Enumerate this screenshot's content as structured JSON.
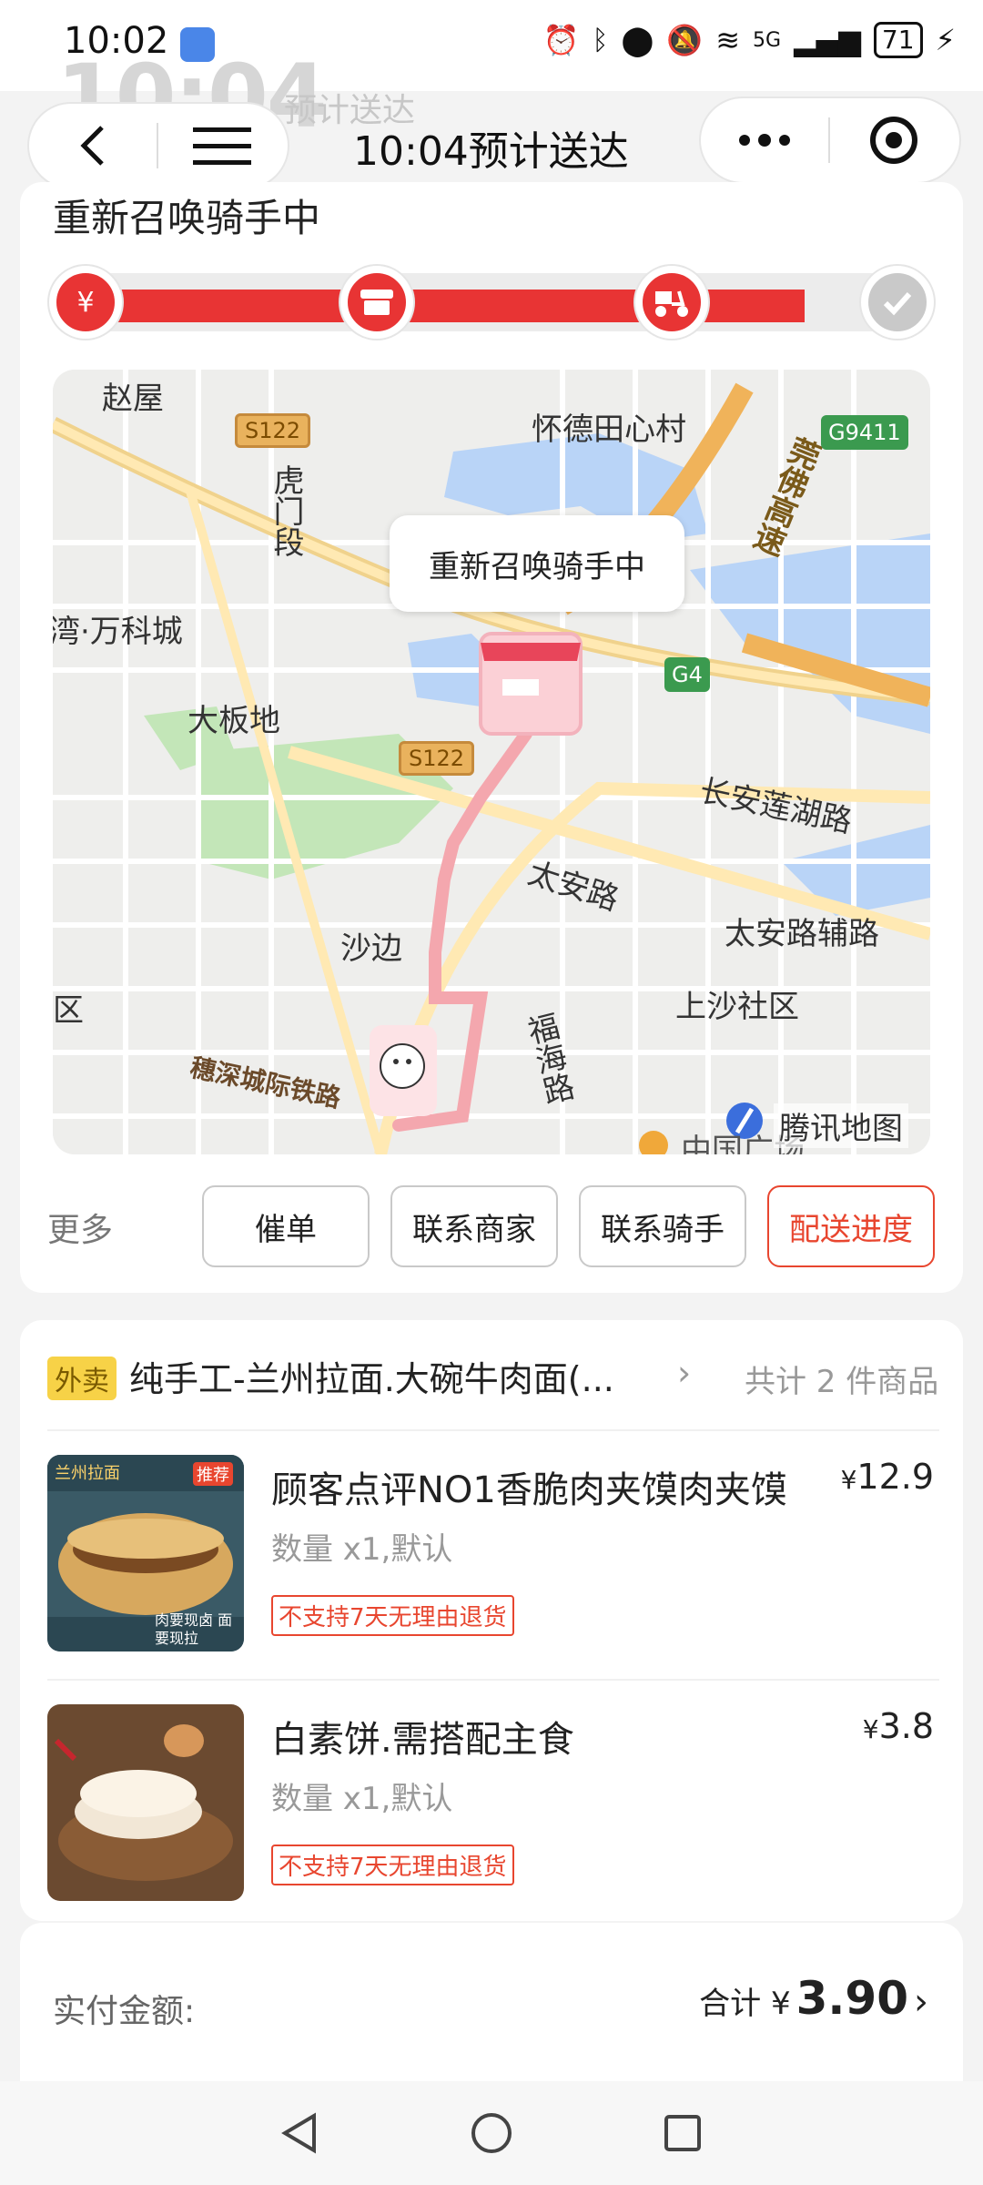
{
  "status_bar": {
    "time": "10:02",
    "network": "5G",
    "battery": "71"
  },
  "header": {
    "overlay_time": "10:04",
    "overlay_label": "预计送达",
    "title": "10:04预计送达"
  },
  "order_status": {
    "text": "重新召唤骑手中",
    "progress": 0.86,
    "step_icons": [
      "payment-icon",
      "store-icon",
      "scooter-icon",
      "check-icon"
    ]
  },
  "map": {
    "bubble": "重新召唤骑手中",
    "labels": {
      "zhaowu": "赵屋",
      "huaide": "怀德田心村",
      "humen": "虎门段",
      "vanke": "湾·万科城",
      "dabandi": "大板地",
      "changan": "长安莲湖路",
      "taian": "太安路",
      "taian_fu": "太安路辅路",
      "shabian": "沙边",
      "shangsha": "上沙社区",
      "fuhai": "福海路",
      "suishen": "穗深城际铁路",
      "guanfo": "莞佛高速",
      "qu": "区",
      "bottom_partial": "中国广场"
    },
    "shields": {
      "s122a": "S122",
      "s122b": "S122",
      "g4": "G4",
      "g9411": "G9411"
    },
    "watermark": "腾讯地图"
  },
  "actions": {
    "more": "更多",
    "urge": "催单",
    "contact_merchant": "联系商家",
    "contact_rider": "联系骑手",
    "delivery_progress": "配送进度"
  },
  "shop": {
    "tag": "外卖",
    "name": "纯手工-兰州拉面.大碗牛肉面(...",
    "item_count": "共计 2 件商品"
  },
  "items": [
    {
      "name": "顾客点评NO1香脆肉夹馍肉夹馍",
      "qty": "数量 x1,默认",
      "badge": "不支持7天无理由退货",
      "currency": "¥",
      "price": "12.9",
      "thumb_tag": "推荐",
      "thumb_title": "兰州拉面",
      "thumb_caption": "肉要现卤 面要现拉"
    },
    {
      "name": "白素饼.需搭配主食",
      "qty": "数量 x1,默认",
      "badge": "不支持7天无理由退货",
      "currency": "¥",
      "price": "3.8"
    }
  ],
  "payment": {
    "label": "实付金额:",
    "total_prefix": "合计 ¥",
    "total": "3.90"
  }
}
